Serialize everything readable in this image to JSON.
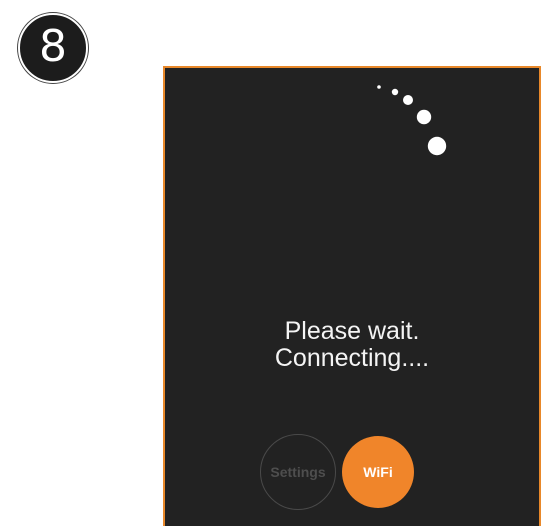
{
  "step": {
    "number": "8"
  },
  "screen": {
    "status_line1": "Please wait.",
    "status_line2": "Connecting....",
    "spinner_icon": "loading-dots-icon",
    "accent_color": "#f0852a",
    "background_color": "#222222"
  },
  "buttons": {
    "settings_label": "Settings",
    "wifi_label": "WiFi"
  }
}
